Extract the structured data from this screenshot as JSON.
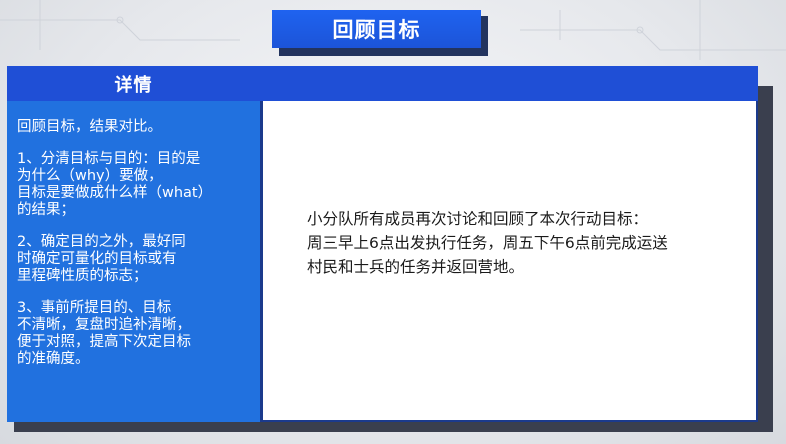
{
  "title": "回顾目标",
  "detail_label": "详情",
  "left_points": [
    "回顾目标，结果对比。",
    "1、分清目标与目的：目的是\n为什么（why）要做，\n目标是要做成什么样（what）\n的结果；",
    "2、确定目的之外，最好同\n时确定可量化的目标或有\n里程碑性质的标志；",
    "3、事前所提目的、目标\n不清晰，复盘时追补清晰，\n便于对照，提高下次定目标\n的准确度。"
  ],
  "content": "小分队所有成员再次讨论和回顾了本次行动目标：\n周三早上6点出发执行任务，周五下午6点前完成运送\n村民和士兵的任务并返回营地。",
  "colors": {
    "title_blue": "#1f63f0",
    "header_blue": "#1f4fd6",
    "panel_blue": "#2171df",
    "shadow": "#3a3f4e"
  }
}
